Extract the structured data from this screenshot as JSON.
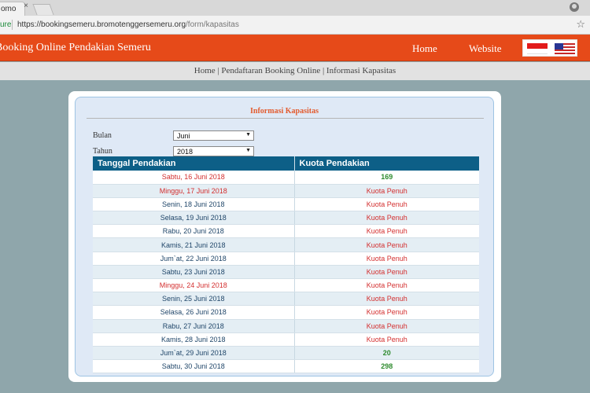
{
  "browser": {
    "tab_label": "omo",
    "tab_close": "×",
    "secure_label": "ure",
    "url_host": "https://bookingsemeru.bromotenggersemeru.org",
    "url_path": "/form/kapasitas",
    "star": "☆"
  },
  "header": {
    "title": "Booking Online Pendakian Semeru",
    "nav_home": "Home",
    "nav_website": "Website"
  },
  "breadcrumb": "Home | Pendaftaran Booking Online | Informasi Kapasitas",
  "panel": {
    "title": "Informasi Kapasitas",
    "bulan_label": "Bulan",
    "bulan_value": "Juni",
    "tahun_label": "Tahun",
    "tahun_value": "2018"
  },
  "table": {
    "headers": [
      "Tanggal Pendakian",
      "Kuota Pendakian"
    ],
    "rows": [
      {
        "date": "Sabtu, 16 Juni 2018",
        "quota": "169",
        "weekend": true,
        "available": true
      },
      {
        "date": "Minggu, 17 Juni 2018",
        "quota": "Kuota Penuh",
        "weekend": true,
        "available": false
      },
      {
        "date": "Senin, 18 Juni 2018",
        "quota": "Kuota Penuh",
        "weekend": false,
        "available": false
      },
      {
        "date": "Selasa, 19 Juni 2018",
        "quota": "Kuota Penuh",
        "weekend": false,
        "available": false
      },
      {
        "date": "Rabu, 20 Juni 2018",
        "quota": "Kuota Penuh",
        "weekend": false,
        "available": false
      },
      {
        "date": "Kamis, 21 Juni 2018",
        "quota": "Kuota Penuh",
        "weekend": false,
        "available": false
      },
      {
        "date": "Jum`at, 22 Juni 2018",
        "quota": "Kuota Penuh",
        "weekend": false,
        "available": false
      },
      {
        "date": "Sabtu, 23 Juni 2018",
        "quota": "Kuota Penuh",
        "weekend": false,
        "available": false
      },
      {
        "date": "Minggu, 24 Juni 2018",
        "quota": "Kuota Penuh",
        "weekend": true,
        "available": false
      },
      {
        "date": "Senin, 25 Juni 2018",
        "quota": "Kuota Penuh",
        "weekend": false,
        "available": false
      },
      {
        "date": "Selasa, 26 Juni 2018",
        "quota": "Kuota Penuh",
        "weekend": false,
        "available": false
      },
      {
        "date": "Rabu, 27 Juni 2018",
        "quota": "Kuota Penuh",
        "weekend": false,
        "available": false
      },
      {
        "date": "Kamis, 28 Juni 2018",
        "quota": "Kuota Penuh",
        "weekend": false,
        "available": false
      },
      {
        "date": "Jum`at, 29 Juni 2018",
        "quota": "20",
        "weekend": false,
        "available": true
      },
      {
        "date": "Sabtu, 30 Juni 2018",
        "quota": "298",
        "weekend": false,
        "available": true
      }
    ]
  },
  "colors": {
    "header_bg": "#e64a19",
    "table_header_bg": "#0d5f87",
    "weekend_red": "#d32f2f",
    "available_green": "#2e8b2e",
    "page_bg": "#8fa6ab"
  }
}
